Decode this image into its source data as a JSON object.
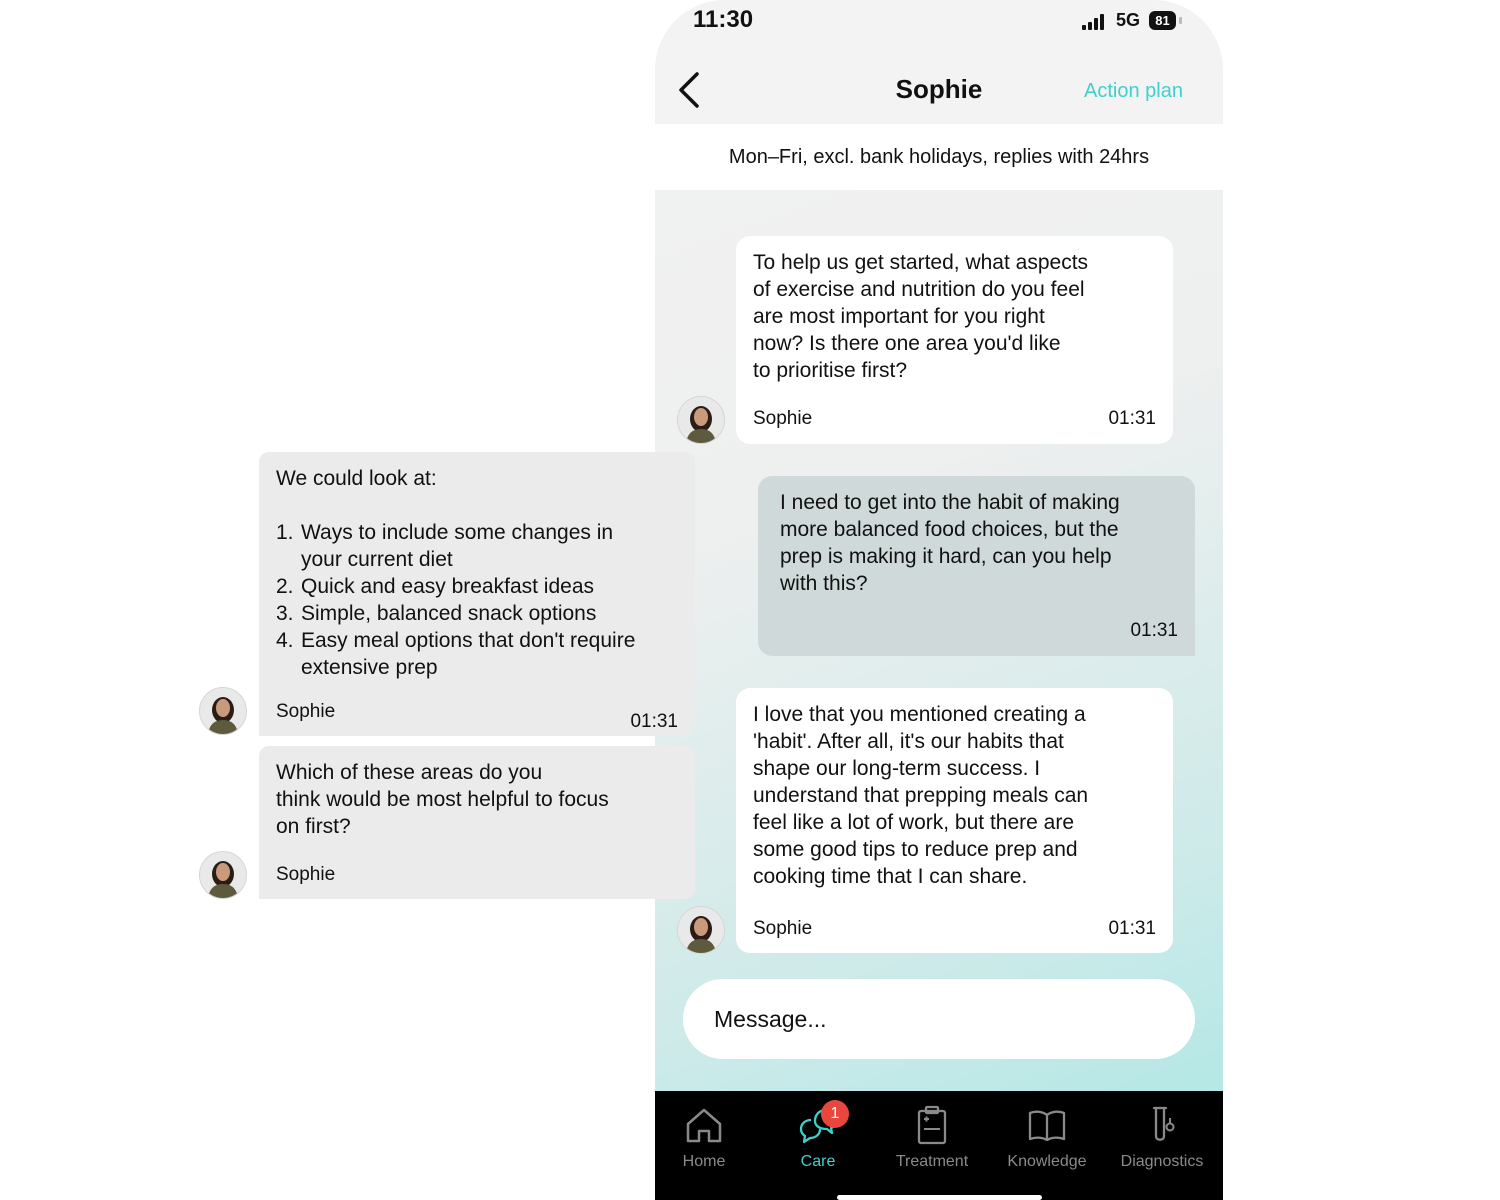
{
  "status_bar": {
    "time": "11:30",
    "network": "5G",
    "battery": "81"
  },
  "header": {
    "title": "Sophie",
    "action_label": "Action plan"
  },
  "availability": "Mon–Fri, excl. bank holidays, replies with 24hrs",
  "messages": [
    {
      "text": "To help us get started, what aspects\nof exercise and nutrition do you feel\nare most important for you right\nnow? Is there one area you'd like\nto prioritise first?",
      "sender": "Sophie",
      "time": "01:31"
    },
    {
      "text": "I need to get into the habit of making\nmore balanced food choices, but the\nprep is making it hard, can you help\nwith this?",
      "time": "01:31"
    },
    {
      "text": "I love that you mentioned creating a\n'habit'. After all, it's our habits that\nshape our long-term success. I\nunderstand that prepping meals can\nfeel like a lot of work, but there are\nsome good tips to reduce prep and\ncooking time that I can share.",
      "sender": "Sophie",
      "time": "01:31"
    }
  ],
  "floating_messages": [
    {
      "intro": "We could look at:",
      "list": [
        {
          "num": "1.",
          "text": "Ways to include some changes in\nyour current diet"
        },
        {
          "num": "2.",
          "text": "Quick and easy breakfast ideas"
        },
        {
          "num": "3.",
          "text": "Simple, balanced snack options"
        },
        {
          "num": "4.",
          "text": "Easy meal options that don't require\nextensive prep"
        }
      ],
      "sender": "Sophie",
      "time": "01:31"
    },
    {
      "text": "Which of these areas do you\nthink would be most helpful to focus\non first?",
      "sender": "Sophie"
    }
  ],
  "input": {
    "placeholder": "Message..."
  },
  "tabs": [
    {
      "label": "Home",
      "icon": "home-icon"
    },
    {
      "label": "Care",
      "icon": "chat-bubbles-icon",
      "active": true,
      "badge": "1"
    },
    {
      "label": "Treatment",
      "icon": "clipboard-icon"
    },
    {
      "label": "Knowledge",
      "icon": "book-icon"
    },
    {
      "label": "Diagnostics",
      "icon": "test-tube-icon"
    }
  ],
  "colors": {
    "accent": "#3fd0cb",
    "badge": "#e8473d",
    "user_bubble": "#cfd9d9",
    "tabbar": "#000000"
  }
}
